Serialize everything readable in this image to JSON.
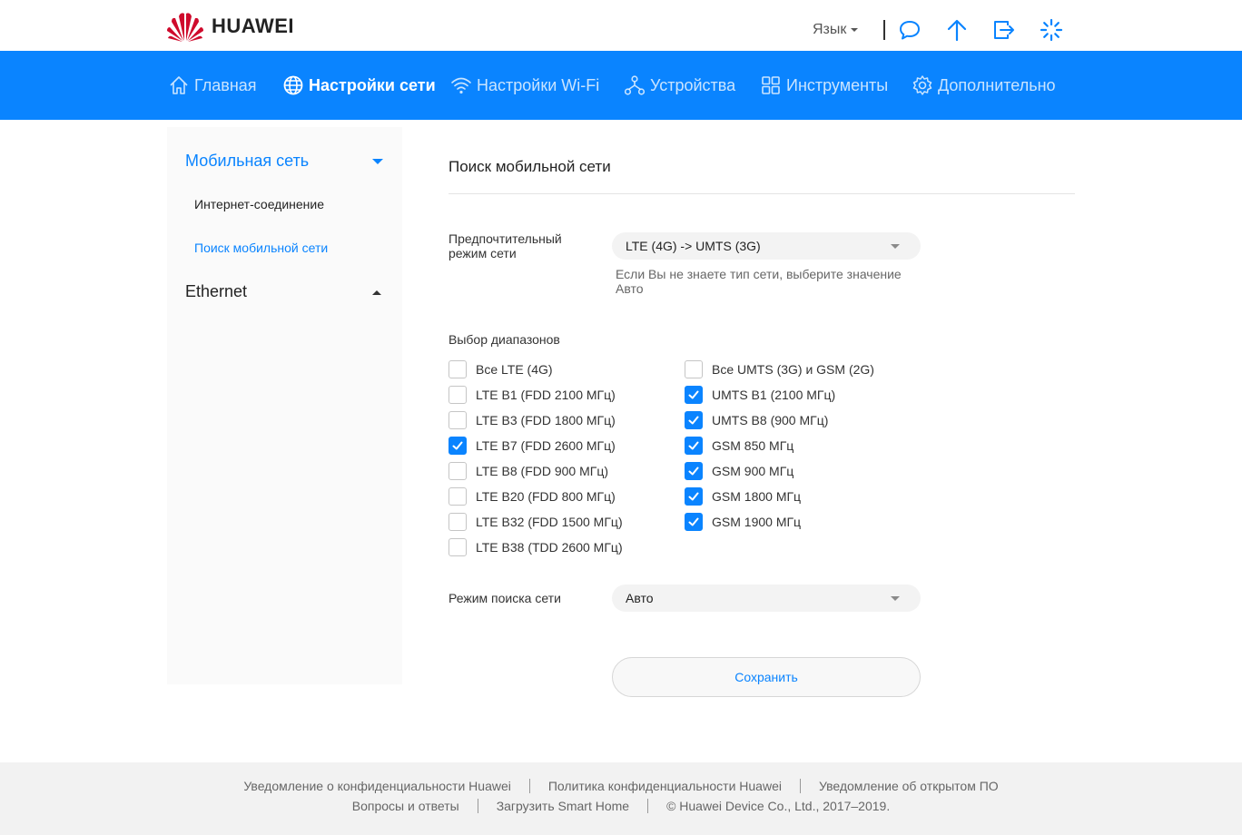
{
  "header": {
    "brand": "HUAWEI",
    "language_label": "Язык"
  },
  "nav": {
    "items": [
      {
        "label": "Главная",
        "icon": "home-icon",
        "active": false
      },
      {
        "label": "Настройки сети",
        "icon": "globe-icon",
        "active": true
      },
      {
        "label": "Настройки Wi-Fi",
        "icon": "wifi-icon",
        "active": false
      },
      {
        "label": "Устройства",
        "icon": "devices-icon",
        "active": false
      },
      {
        "label": "Инструменты",
        "icon": "tools-icon",
        "active": false
      },
      {
        "label": "Дополнительно",
        "icon": "gear-icon",
        "active": false
      }
    ]
  },
  "sidebar": {
    "groups": [
      {
        "label": "Мобильная сеть",
        "expanded": true
      },
      {
        "label": "Ethernet",
        "expanded": false
      }
    ],
    "subitems": [
      {
        "label": "Интернет-соединение",
        "active": false
      },
      {
        "label": "Поиск мобильной сети",
        "active": true
      }
    ]
  },
  "main": {
    "title": "Поиск мобильной сети",
    "preferred_mode": {
      "label": "Предпочтительный режим сети",
      "value": "LTE (4G) -> UMTS (3G)",
      "hint": "Если Вы не знаете тип сети, выберите значение Авто"
    },
    "bands": {
      "label": "Выбор диапазонов",
      "left": [
        {
          "label": "Все LTE (4G)",
          "checked": false
        },
        {
          "label": "LTE B1 (FDD 2100 МГц)",
          "checked": false
        },
        {
          "label": "LTE B3 (FDD 1800 МГц)",
          "checked": false
        },
        {
          "label": "LTE B7 (FDD 2600 МГц)",
          "checked": true
        },
        {
          "label": "LTE B8 (FDD 900 МГц)",
          "checked": false
        },
        {
          "label": "LTE B20 (FDD 800 МГц)",
          "checked": false
        },
        {
          "label": "LTE B32 (FDD 1500 МГц)",
          "checked": false
        },
        {
          "label": "LTE B38 (TDD 2600 МГц)",
          "checked": false
        }
      ],
      "right": [
        {
          "label": "Все UMTS (3G) и GSM (2G)",
          "checked": false
        },
        {
          "label": "UMTS B1 (2100 МГц)",
          "checked": true
        },
        {
          "label": "UMTS B8 (900 МГц)",
          "checked": true
        },
        {
          "label": "GSM 850 МГц",
          "checked": true
        },
        {
          "label": "GSM 900 МГц",
          "checked": true
        },
        {
          "label": "GSM 1800 МГц",
          "checked": true
        },
        {
          "label": "GSM 1900 МГц",
          "checked": true
        }
      ]
    },
    "search_mode": {
      "label": "Режим поиска сети",
      "value": "Авто"
    },
    "save_label": "Сохранить"
  },
  "footer": {
    "row1": [
      "Уведомление о конфиденциальности Huawei",
      "Политика конфиденциальности Huawei",
      "Уведомление об открытом ПО"
    ],
    "row2": [
      "Вопросы и ответы",
      "Загрузить Smart Home",
      "© Huawei Device Co., Ltd., 2017–2019."
    ]
  },
  "colors": {
    "accent": "#0a84ff",
    "brand_red": "#cf0a2c"
  }
}
